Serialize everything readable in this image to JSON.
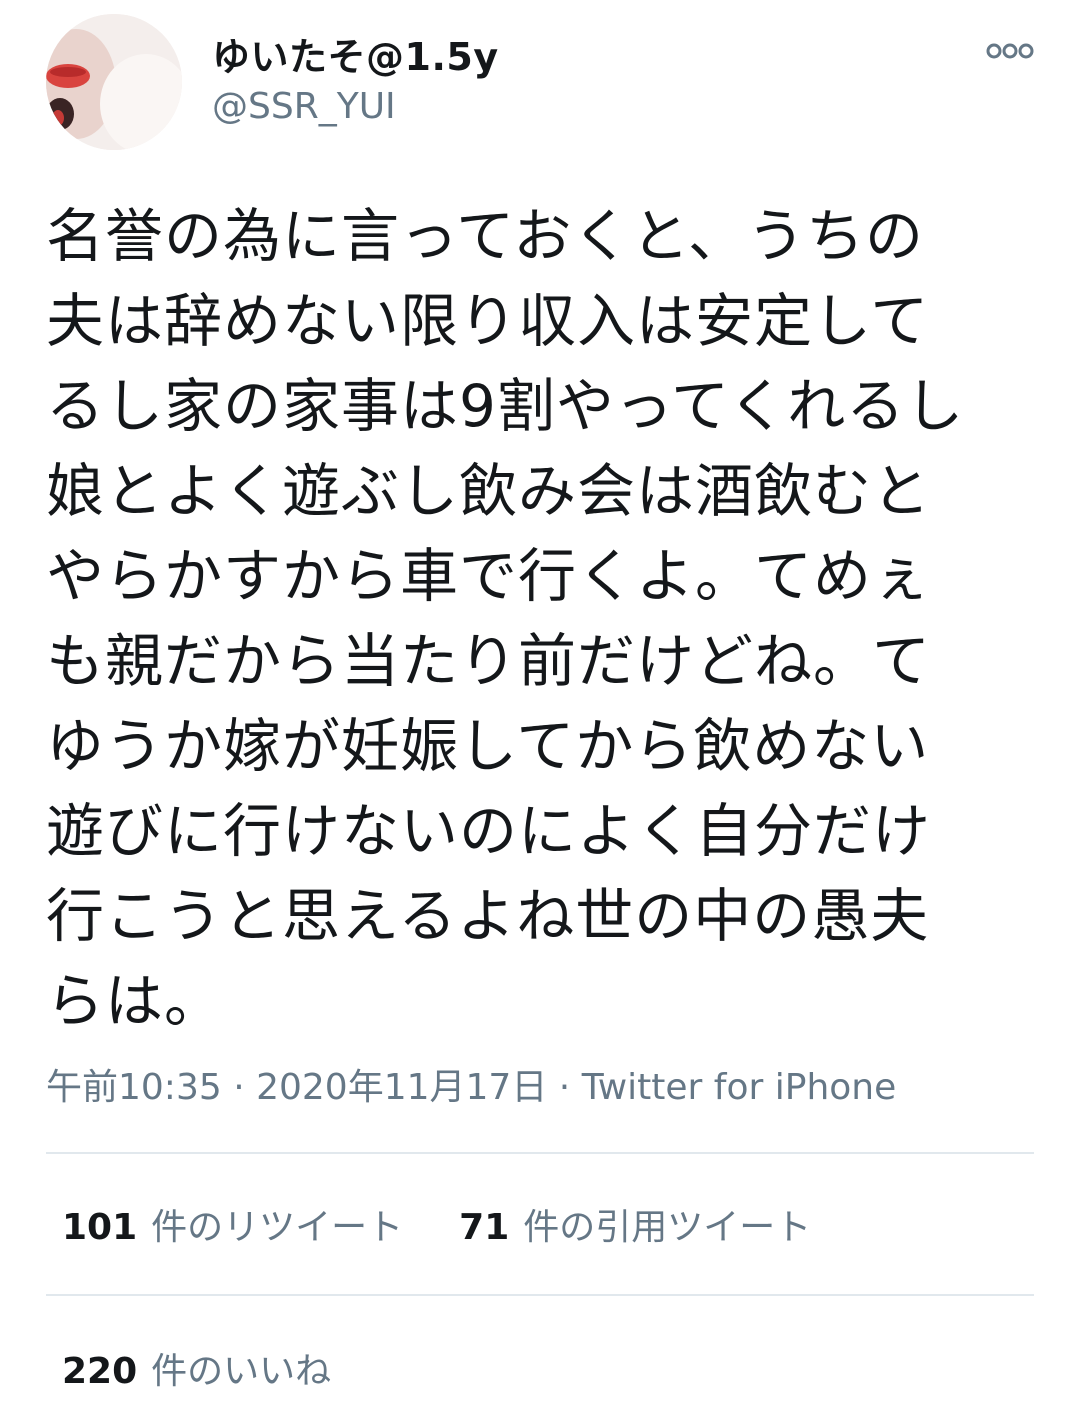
{
  "user": {
    "display_name": "ゆいたそ@1.5y",
    "handle": "@SSR_YUI"
  },
  "icons": {
    "more": "more-options-icon",
    "avatar": "profile-photo"
  },
  "tweet": {
    "text": "名誉の為に言っておくと、うちの\n夫は辞めない限り収入は安定して\nるし家の家事は9割やってくれるし\n娘とよく遊ぶし飲み会は酒飲むと\nやらかすから車で行くよ。てめぇ\nも親だから当たり前だけどね。て\nゆうか嫁が妊娠してから飲めない\n遊びに行けないのによく自分だけ\n行こうと思えるよね世の中の愚夫\nらは。",
    "time": "午前10:35",
    "separator": " · ",
    "date": "2020年11月17日",
    "separator2": " · ",
    "source": "Twitter for iPhone"
  },
  "stats": {
    "retweets_count": "101",
    "retweets_label": "件のリツイート",
    "quotes_count": "71",
    "quotes_label": "件の引用ツイート",
    "likes_count": "220",
    "likes_label": "件のいいね"
  },
  "colors": {
    "text": "#14171a",
    "secondary": "#657786",
    "divider": "#e1e8ed"
  }
}
